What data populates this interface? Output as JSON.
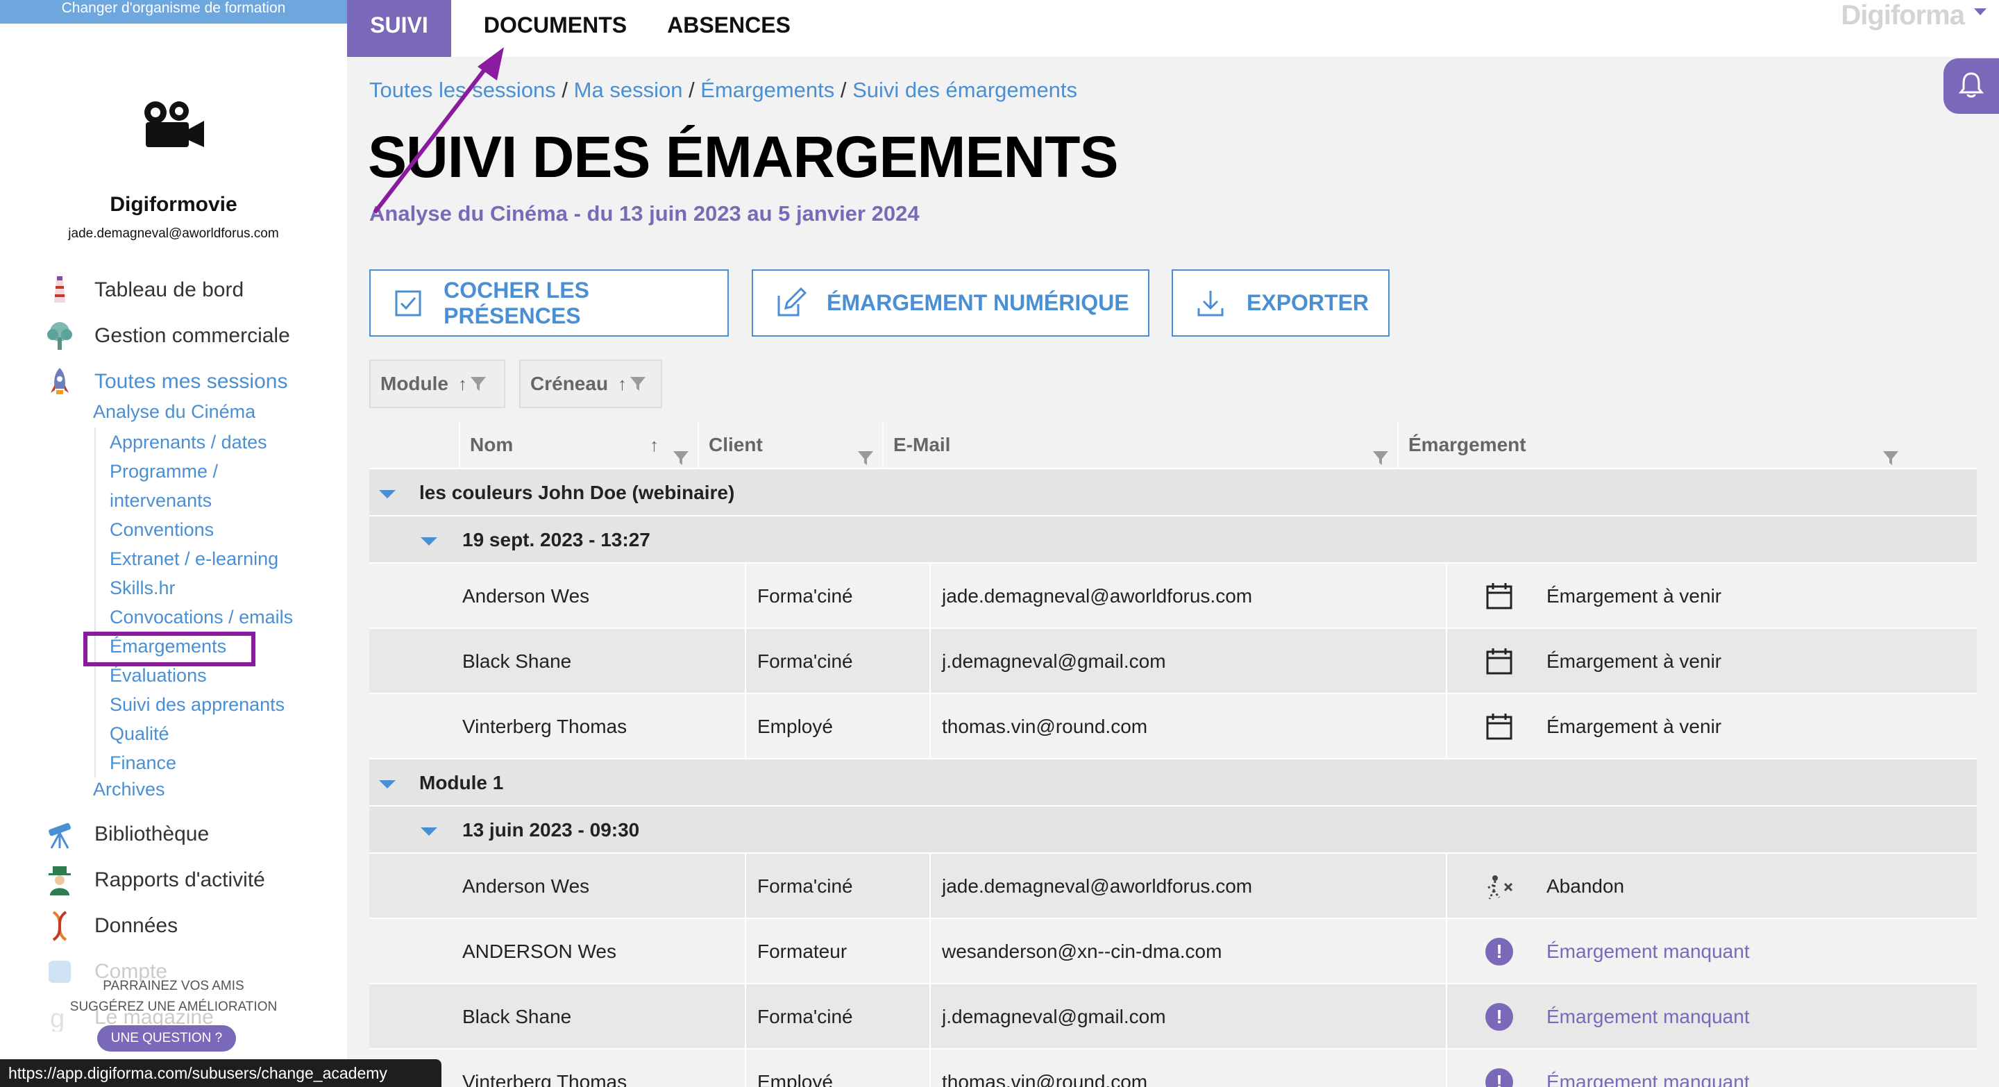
{
  "sidebar": {
    "change_org": "Changer d'organisme de formation",
    "org_name": "Digiformovie",
    "org_email": "jade.demagneval@aworldforus.com",
    "nav": {
      "dashboard": "Tableau de bord",
      "commercial": "Gestion commerciale",
      "sessions": "Toutes mes sessions",
      "library": "Bibliothèque",
      "reports": "Rapports d'activité",
      "data": "Données",
      "account": "Compte",
      "magazine": "Le magazine"
    },
    "current_session": "Analyse du Cinéma",
    "session_items": [
      "Apprenants / dates",
      "Programme /",
      "intervenants",
      "Conventions",
      "Extranet / e-learning",
      "Skills.hr",
      "Convocations / emails",
      "Émargements",
      "Évaluations",
      "Suivi des apprenants",
      "Qualité",
      "Finance"
    ],
    "archives": "Archives",
    "footer_refer": "PARRAINEZ VOS AMIS",
    "footer_suggest": "SUGGÉREZ UNE AMÉLIORATION",
    "question_btn": "UNE QUESTION ?"
  },
  "status_url": "https://app.digiforma.com/subusers/change_academy",
  "topnav": {
    "tabs": [
      "SUIVI",
      "DOCUMENTS",
      "ABSENCES"
    ],
    "brand": "Digiforma"
  },
  "breadcrumb": {
    "items": [
      "Toutes les sessions",
      "Ma session",
      "Émargements",
      "Suivi des émargements"
    ],
    "separator": " / "
  },
  "page": {
    "title": "SUIVI DES ÉMARGEMENTS",
    "subtitle": "Analyse du Cinéma - du 13 juin 2023 au 5 janvier 2024"
  },
  "actions": {
    "check": "COCHER LES PRÉSENCES",
    "digital": "ÉMARGEMENT NUMÉRIQUE",
    "export": "EXPORTER"
  },
  "group_chips": [
    "Module",
    "Créneau"
  ],
  "table": {
    "headers": {
      "nom": "Nom",
      "client": "Client",
      "email": "E-Mail",
      "emargement": "Émargement"
    },
    "groups": [
      {
        "label": "les couleurs John Doe (webinaire)",
        "slots": [
          {
            "label": "19 sept. 2023 - 13:27",
            "rows": [
              {
                "nom": "Anderson Wes",
                "client": "Forma'ciné",
                "email": "jade.demagneval@aworldforus.com",
                "status": "Émargement à venir",
                "icon": "calendar-icon"
              },
              {
                "nom": "Black Shane",
                "client": "Forma'ciné",
                "email": "j.demagneval@gmail.com",
                "status": "Émargement à venir",
                "icon": "calendar-icon"
              },
              {
                "nom": "Vinterberg Thomas",
                "client": "Employé",
                "email": "thomas.vin@round.com",
                "status": "Émargement à venir",
                "icon": "calendar-icon"
              }
            ]
          }
        ]
      },
      {
        "label": "Module 1",
        "slots": [
          {
            "label": "13 juin 2023 - 09:30",
            "rows": [
              {
                "nom": "Anderson Wes",
                "client": "Forma'ciné",
                "email": "jade.demagneval@aworldforus.com",
                "status": "Abandon",
                "icon": "abandon-icon"
              },
              {
                "nom": "ANDERSON Wes",
                "client": "Formateur",
                "email": "wesanderson@xn--cin-dma.com",
                "status": "Émargement manquant",
                "icon": "alert-icon"
              },
              {
                "nom": "Black Shane",
                "client": "Forma'ciné",
                "email": "j.demagneval@gmail.com",
                "status": "Émargement manquant",
                "icon": "alert-icon"
              },
              {
                "nom": "Vinterberg Thomas",
                "client": "Employé",
                "email": "thomas.vin@round.com",
                "status": "Émargement manquant",
                "icon": "alert-icon"
              }
            ]
          }
        ]
      }
    ]
  },
  "colors": {
    "accent_purple": "#7a68b8",
    "link_blue": "#4a8fd4",
    "annotation_purple": "#8a1a9e"
  }
}
